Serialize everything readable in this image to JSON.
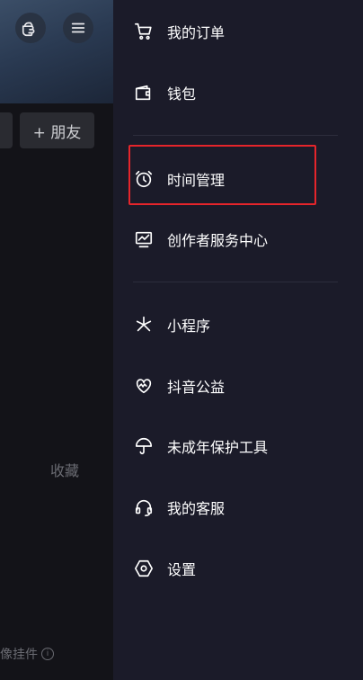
{
  "background": {
    "friend_button": "+ 朋友",
    "collect_label": "收藏",
    "pendant_label": "像挂件",
    "info_glyph": "i"
  },
  "drawer": {
    "items": [
      {
        "label": "我的订单",
        "icon": "cart-icon"
      },
      {
        "label": "钱包",
        "icon": "wallet-icon"
      },
      {
        "label": "时间管理",
        "icon": "alarm-clock-icon"
      },
      {
        "label": "创作者服务中心",
        "icon": "chart-monitor-icon"
      },
      {
        "label": "小程序",
        "icon": "asterisk-icon"
      },
      {
        "label": "抖音公益",
        "icon": "heart-icon"
      },
      {
        "label": "未成年保护工具",
        "icon": "umbrella-icon"
      },
      {
        "label": "我的客服",
        "icon": "headset-icon"
      },
      {
        "label": "设置",
        "icon": "settings-hexagon-icon"
      }
    ]
  },
  "colors": {
    "drawer_bg": "#1b1b29",
    "highlight": "#e5252b",
    "text": "#ffffff"
  }
}
